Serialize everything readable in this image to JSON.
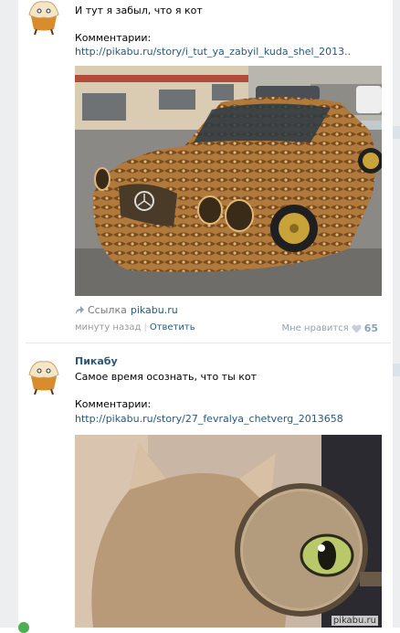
{
  "posts": [
    {
      "text": "И тут я забыл, что я кот",
      "comments_label": "Комментарии:",
      "comments_url": "http://pikabu.ru/story/i_tut_ya_zabyil_kuda_shel_2013..",
      "image_caption": "",
      "source_prefix": "Ссылка",
      "source_domain": "pikabu.ru",
      "time": "минуту назад",
      "reply": "Ответить",
      "like_label": "Мне нравится",
      "like_count": "65"
    },
    {
      "author": "Пикабу",
      "text": "Самое время осознать, что ты кот",
      "comments_label": "Комментарии:",
      "comments_url": "http://pikabu.ru/story/27_fevralya_chetverg_2013658"
    }
  ],
  "watermark": "pikabu.ru",
  "colors": {
    "link": "#2b587a",
    "meta": "#999999",
    "background": "#ffffff",
    "gutter": "#edeef0"
  }
}
